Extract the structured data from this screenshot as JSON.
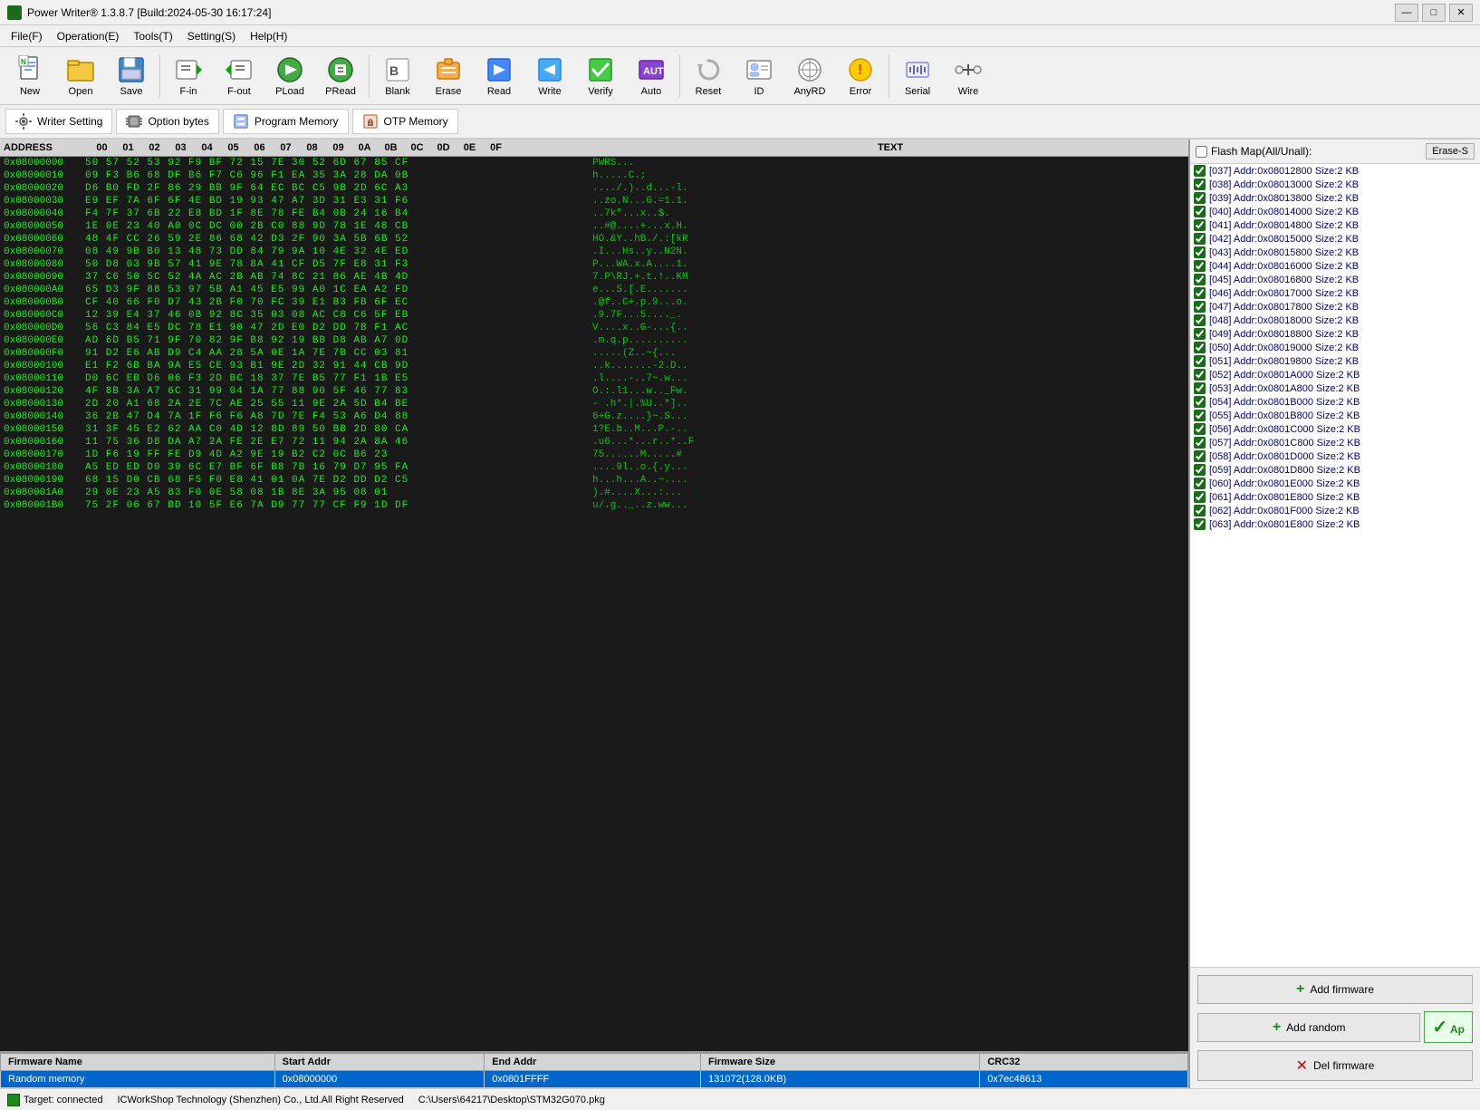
{
  "app": {
    "title": "Power Writer® 1.3.8.7 [Build:2024-05-30 16:17:24]"
  },
  "menu": {
    "items": [
      {
        "label": "File(F)"
      },
      {
        "label": "Operation(E)"
      },
      {
        "label": "Tools(T)"
      },
      {
        "label": "Setting(S)"
      },
      {
        "label": "Help(H)"
      }
    ]
  },
  "toolbar": {
    "buttons": [
      {
        "label": "New",
        "icon": "new-icon"
      },
      {
        "label": "Open",
        "icon": "open-icon"
      },
      {
        "label": "Save",
        "icon": "save-icon"
      },
      {
        "label": "F-in",
        "icon": "fin-icon"
      },
      {
        "label": "F-out",
        "icon": "fout-icon"
      },
      {
        "label": "PLoad",
        "icon": "pload-icon"
      },
      {
        "label": "PRead",
        "icon": "pread-icon"
      },
      {
        "label": "Blank",
        "icon": "blank-icon"
      },
      {
        "label": "Erase",
        "icon": "erase-icon"
      },
      {
        "label": "Read",
        "icon": "read-icon"
      },
      {
        "label": "Write",
        "icon": "write-icon"
      },
      {
        "label": "Verify",
        "icon": "verify-icon"
      },
      {
        "label": "Auto",
        "icon": "auto-icon"
      },
      {
        "label": "Reset",
        "icon": "reset-icon"
      },
      {
        "label": "ID",
        "icon": "id-icon"
      },
      {
        "label": "AnyRD",
        "icon": "anyrd-icon"
      },
      {
        "label": "Error",
        "icon": "error-icon"
      },
      {
        "label": "Serial",
        "icon": "serial-icon"
      },
      {
        "label": "Wire",
        "icon": "wire-icon"
      }
    ]
  },
  "subtoolbar": {
    "buttons": [
      {
        "label": "Writer Setting",
        "icon": "gear"
      },
      {
        "label": "Option bytes",
        "icon": "chip"
      },
      {
        "label": "Program Memory",
        "icon": "mem"
      },
      {
        "label": "OTP Memory",
        "icon": "otp"
      }
    ]
  },
  "hex": {
    "header": {
      "addr": "ADDRESS",
      "bytes": [
        "00",
        "01",
        "02",
        "03",
        "04",
        "05",
        "06",
        "07",
        "08",
        "09",
        "0A",
        "0B",
        "0C",
        "0D",
        "0E",
        "0F"
      ],
      "text": "TEXT"
    },
    "rows": [
      {
        "addr": "0x08000000",
        "hex": "50 57 52 53 92 F9 BF 72 15 7E 30 52 6D 67 85 CF",
        "text": "PWRS..."
      },
      {
        "addr": "0x08000010",
        "hex": "09 F3 B6 68 DF B6 F7 C6 96 F1 EA 35 3A 28 DA 0B",
        "text": "h.....C.;"
      },
      {
        "addr": "0x08000020",
        "hex": "D6 B0 FD 2F 86 29 BB 9F 64 EC BC C5 9B 2D 6C A3",
        "text": "..../.)..d...-l."
      },
      {
        "addr": "0x08000030",
        "hex": "E9 EF 7A 6F 6F 4E BD 19 93 47 A7 3D 31 E3 31 F6",
        "text": "..zo.N...G.=1.1."
      },
      {
        "addr": "0x08000040",
        "hex": "F4 7F 37 6B 22 E8 BD 1F 8E 78 FE B4 0B 24 16 B4",
        "text": "..7k\"...x..$."
      },
      {
        "addr": "0x08000050",
        "hex": "1E 0E 23 40 A0 0C DC 00 2B C0 88 9D 78 1E 48 CB",
        "text": "..#@....+...x.H."
      },
      {
        "addr": "0x08000060",
        "hex": "48 4F CC 26 59 2E 86 68 42 D3 2F 90 3A 5B 6B 52",
        "text": "HO.&Y..hB./.:[kR"
      },
      {
        "addr": "0x08000070",
        "hex": "08 49 9B B0 13 48 73 DD 84 79 9A 10 4E 32 4E ED",
        "text": ".I...Hs..y..N2N."
      },
      {
        "addr": "0x08000080",
        "hex": "50 D8 03 9B 57 41 9E 78 8A 41 CF D5 7F E8 31 F3",
        "text": "P...WA.x.A....1."
      },
      {
        "addr": "0x08000090",
        "hex": "37 C6 50 5C 52 4A AC 2B AB 74 8C 21 86 AE 4B 4D",
        "text": "7.P\\RJ.+.t.!..KM"
      },
      {
        "addr": "0x080000A0",
        "hex": "65 D3 9F 88 53 97 5B A1 45 E5 99 A0 1C EA A2 FD",
        "text": "e...S.[.E......."
      },
      {
        "addr": "0x080000B0",
        "hex": "CF 40 66 F0 D7 43 2B F0 70 FC 39 E1 B3 FB 6F EC",
        "text": ".@f..C+.p.9...o."
      },
      {
        "addr": "0x080000C0",
        "hex": "12 39 E4 37 46 0B 92 8C 35 03 08 AC C8 C6 5F EB",
        "text": ".9.7F...5...._."
      },
      {
        "addr": "0x080000D0",
        "hex": "56 C3 84 E5 DC 78 E1 90 47 2D E0 D2 DD 7B F1 AC",
        "text": "V....x..G-...{.."
      },
      {
        "addr": "0x080000E0",
        "hex": "AD 6D B5 71 9F 70 82 9F B8 92 19 BB D8 AB A7 0D",
        "text": ".m.q.p.........."
      },
      {
        "addr": "0x080000F0",
        "hex": "91 D2 E6 AB D9 C4 AA 28 5A 0E 1A 7E 7B CC 03 81",
        "text": ".....(Z..~{..."
      },
      {
        "addr": "0x08000100",
        "hex": "E1 F2 6B BA 9A E5 CE 93 B1 9E 2D 32 91 44 CB 9D",
        "text": "..k.......-2.D.."
      },
      {
        "addr": "0x08000110",
        "hex": "D0 6C EB D6 06 F3 2D BC 18 37 7E B5 77 F1 1B E5",
        "text": ".l....-..7~.w..."
      },
      {
        "addr": "0x08000120",
        "hex": "4F 8B 3A A7 6C 31 99 04 1A 77 88 90 5F 46 77 83",
        "text": "O.:.l1...w.._Fw."
      },
      {
        "addr": "0x08000130",
        "hex": "2D 20 A1 68 2A 2E 7C AE 25 55 11 9E 2A 5D B4 BE",
        "text": "- .h*.|.%U..*].."
      },
      {
        "addr": "0x08000140",
        "hex": "36 2B 47 D4 7A 1F F6 F6 A8 7D 7E F4 53 A6 D4 88",
        "text": "6+G.z....}~.S..."
      },
      {
        "addr": "0x08000150",
        "hex": "31 3F 45 E2 62 AA C0 4D 12 8D 89 50 BB 2D 80 CA",
        "text": "1?E.b..M...P.-.."
      },
      {
        "addr": "0x08000160",
        "hex": "11 75 36 D8 DA A7 2A FE 2E E7 72 11 94 2A 8A 46",
        "text": ".u6...*...r..*..F"
      },
      {
        "addr": "0x08000170",
        "hex": "1D F6 19 FF FE D9 4D A2 9E 19 B2 C2 0C B6 23 ",
        "text": "75......M.....#"
      },
      {
        "addr": "0x08000180",
        "hex": "A5 ED ED D0 39 6C E7 BF 6F B8 7B 16 79 D7 95 FA",
        "text": "....9l..o.{.y..."
      },
      {
        "addr": "0x08000190",
        "hex": "68 15 D0 CB 68 F5 F0 E8 41 01 0A 7E D2 DD D2 C5",
        "text": "h...h...A..~...."
      },
      {
        "addr": "0x080001A0",
        "hex": "29 0E 23 A5 83 F0 0E 58 08 1B 8E 3A 95 08 01 ",
        "text": ").#....X...:..."
      },
      {
        "addr": "0x080001B0",
        "hex": "75 2F 06 67 BD 10 5F E6 7A D9 77 77 CF F9 1D DF",
        "text": "u/.g.._..z.ww..."
      }
    ]
  },
  "flash_map": {
    "header": "Flash Map(All/Unall):",
    "erase_btn": "Erase-S",
    "items": [
      {
        "checked": true,
        "label": "[037] Addr:0x08012800 Size:2 KB"
      },
      {
        "checked": true,
        "label": "[038] Addr:0x08013000 Size:2 KB"
      },
      {
        "checked": true,
        "label": "[039] Addr:0x08013800 Size:2 KB"
      },
      {
        "checked": true,
        "label": "[040] Addr:0x08014000 Size:2 KB"
      },
      {
        "checked": true,
        "label": "[041] Addr:0x08014800 Size:2 KB"
      },
      {
        "checked": true,
        "label": "[042] Addr:0x08015000 Size:2 KB"
      },
      {
        "checked": true,
        "label": "[043] Addr:0x08015800 Size:2 KB"
      },
      {
        "checked": true,
        "label": "[044] Addr:0x08016000 Size:2 KB"
      },
      {
        "checked": true,
        "label": "[045] Addr:0x08016800 Size:2 KB"
      },
      {
        "checked": true,
        "label": "[046] Addr:0x08017000 Size:2 KB"
      },
      {
        "checked": true,
        "label": "[047] Addr:0x08017800 Size:2 KB"
      },
      {
        "checked": true,
        "label": "[048] Addr:0x08018000 Size:2 KB"
      },
      {
        "checked": true,
        "label": "[049] Addr:0x08018800 Size:2 KB"
      },
      {
        "checked": true,
        "label": "[050] Addr:0x08019000 Size:2 KB"
      },
      {
        "checked": true,
        "label": "[051] Addr:0x08019800 Size:2 KB"
      },
      {
        "checked": true,
        "label": "[052] Addr:0x0801A000 Size:2 KB"
      },
      {
        "checked": true,
        "label": "[053] Addr:0x0801A800 Size:2 KB"
      },
      {
        "checked": true,
        "label": "[054] Addr:0x0801B000 Size:2 KB"
      },
      {
        "checked": true,
        "label": "[055] Addr:0x0801B800 Size:2 KB"
      },
      {
        "checked": true,
        "label": "[056] Addr:0x0801C000 Size:2 KB"
      },
      {
        "checked": true,
        "label": "[057] Addr:0x0801C800 Size:2 KB"
      },
      {
        "checked": true,
        "label": "[058] Addr:0x0801D000 Size:2 KB"
      },
      {
        "checked": true,
        "label": "[059] Addr:0x0801D800 Size:2 KB"
      },
      {
        "checked": true,
        "label": "[060] Addr:0x0801E000 Size:2 KB"
      },
      {
        "checked": true,
        "label": "[061] Addr:0x0801E800 Size:2 KB"
      },
      {
        "checked": true,
        "label": "[062] Addr:0x0801F000 Size:2 KB"
      },
      {
        "checked": true,
        "label": "[063] Addr:0x0801E800 Size:2 KB"
      }
    ]
  },
  "right_buttons": {
    "add_firmware": "+ Add firmware",
    "add_random": "+ Add random",
    "apply": "Ap",
    "del_firmware": "✕ Del firmware"
  },
  "firmware_table": {
    "headers": [
      "Firmware Name",
      "Start Addr",
      "End Addr",
      "Firmware Size",
      "CRC32"
    ],
    "rows": [
      {
        "name": "Random memory",
        "start": "0x08000000",
        "end": "0x0801FFFF",
        "size": "131072(128.0KB)",
        "crc": "0x7ec48613"
      }
    ]
  },
  "status_bar": {
    "connected": "Target: connected",
    "company": "ICWorkShop Technology (Shenzhen) Co., Ltd.All Right Reserved",
    "file_path": "C:\\Users\\64217\\Desktop\\STM32G070.pkg"
  }
}
